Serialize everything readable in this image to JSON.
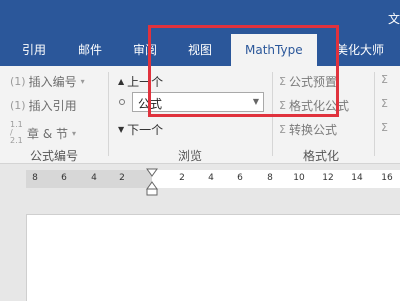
{
  "window": {
    "title_fragment": "文"
  },
  "tabs": [
    {
      "label": "引用",
      "active": false
    },
    {
      "label": "邮件",
      "active": false
    },
    {
      "label": "审阅",
      "active": false
    },
    {
      "label": "视图",
      "active": false
    },
    {
      "label": "MathType",
      "active": true
    },
    {
      "label": "美化大师",
      "active": false
    }
  ],
  "ribbon": {
    "equation_number": {
      "insert_number": "插入编号",
      "insert_number_prefix": "(1)",
      "insert_reference": "插入引用",
      "insert_reference_prefix": "(1)",
      "chapter_section": "章 & 节",
      "chapter_section_prefix": "1.1 / 2.1",
      "group_label": "公式编号"
    },
    "browse": {
      "prev": "上一个",
      "combo_value": "公式",
      "next": "下一个",
      "group_label": "浏览"
    },
    "format": {
      "preset": "公式预置",
      "format_eq": "格式化公式",
      "convert_eq": "转换公式",
      "group_label": "格式化"
    }
  },
  "ruler": {
    "labels": [
      "8",
      "6",
      "4",
      "2",
      "2",
      "4",
      "6",
      "8",
      "10",
      "12",
      "14",
      "16"
    ]
  },
  "colors": {
    "accent": "#2b579a",
    "highlight_box": "#e0323d",
    "ribbon_bg": "#f3f3f3"
  },
  "icons": {
    "prev": "triangle-up-icon",
    "next": "triangle-down-icon",
    "radio": "radio-icon",
    "sigma": "sigma-icon",
    "dropdown": "chevron-down-icon"
  }
}
